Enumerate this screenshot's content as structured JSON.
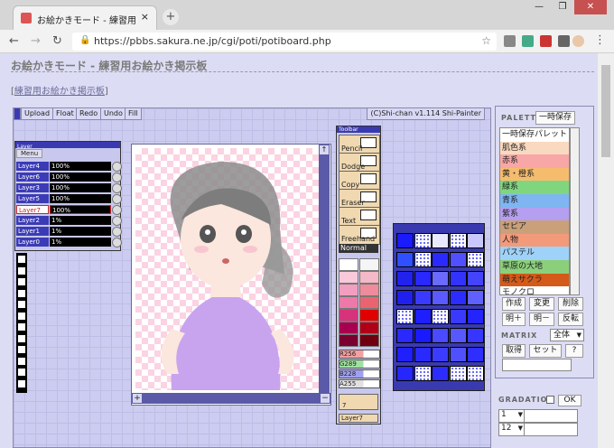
{
  "browser": {
    "tab_title": "お絵かきモード - 練習用お絵かき",
    "tab_close": "×",
    "new_tab": "+",
    "url": "https://pbbs.sakura.ne.jp/cgi/poti/potiboard.php",
    "window_controls": [
      "—",
      "❐",
      "✕"
    ]
  },
  "page": {
    "title": "お絵かきモード - 練習用お絵かき掲示板",
    "back_link_open": "[",
    "back_link": "練習用お絵かき掲示板",
    "back_link_close": "]"
  },
  "applet": {
    "toolbar": [
      "Upload",
      "Float",
      "Redo",
      "Undo",
      "Fill"
    ],
    "credit": "(C)Shi-chan v1.114 Shi-Painter"
  },
  "layers": {
    "menu": "Menu",
    "title": "Layer",
    "rows": [
      {
        "name": "Layer4",
        "opacity": "100%"
      },
      {
        "name": "Layer6",
        "opacity": "100%"
      },
      {
        "name": "Layer3",
        "opacity": "100%"
      },
      {
        "name": "Layer5",
        "opacity": "100%"
      },
      {
        "name": "Layer7",
        "opacity": "100%"
      },
      {
        "name": "Layer2",
        "opacity": "1%"
      },
      {
        "name": "Layer1",
        "opacity": "1%"
      },
      {
        "name": "Layer0",
        "opacity": "1%"
      }
    ]
  },
  "canvas": {
    "scroll_up": "↑",
    "zoom_in": "+",
    "zoom_out": "−"
  },
  "tools": {
    "title": "Toolbar",
    "items": [
      "Pencil",
      "Dodge",
      "Copy",
      "Eraser",
      "Text",
      "Freehand"
    ],
    "mode": "Normal",
    "rgb": [
      "R256",
      "G289",
      "B228",
      "A255"
    ],
    "size": "7",
    "layer": "Layer7",
    "swatches": [
      "#ffffff",
      "#f5f5f5",
      "#f8c9d8",
      "#f3b9c7",
      "#f29ec0",
      "#ef8b9a",
      "#ec79a8",
      "#ea6470",
      "#d6337a",
      "#e00000",
      "#a80050",
      "#b00018",
      "#7a0030",
      "#700010"
    ]
  },
  "textures": {
    "colors": [
      "#1a1aff",
      "#ffffff",
      "#e8e8ff",
      "#ffffff",
      "#c8c8ff",
      "#3050ff",
      "#ffffff",
      "#2a2aff",
      "#5050ff",
      "#ffffff",
      "#2222ee",
      "#2828ff",
      "#6a6aff",
      "#3333ff",
      "#4444ff",
      "#2020ee",
      "#3a3aff",
      "#5a5aff",
      "#2c2cff",
      "#6060ff",
      "#ffffff",
      "#1e1eff",
      "#ffffff",
      "#3a3aff",
      "#2424ff",
      "#2a2aff",
      "#1a1aff",
      "#4a4aff",
      "#5858ff",
      "#3636ff",
      "#2020ff",
      "#2a2aff",
      "#3c3cff",
      "#5050ff",
      "#2e2eff",
      "#2626ff",
      "#ffffff",
      "#2c2cff",
      "#ffffff",
      "#ffffff"
    ]
  },
  "palette": {
    "label": "PALETTE",
    "save_temp": "一時保存",
    "items": [
      {
        "name": "一時保存パレット",
        "color": "#ffffff"
      },
      {
        "name": "肌色系",
        "color": "#f9d9c0"
      },
      {
        "name": "赤系",
        "color": "#f8a6a6"
      },
      {
        "name": "黄・橙系",
        "color": "#f6bc6e"
      },
      {
        "name": "緑系",
        "color": "#7fd67f"
      },
      {
        "name": "青系",
        "color": "#7fb6f2"
      },
      {
        "name": "紫系",
        "color": "#b59ff0"
      },
      {
        "name": "セピア",
        "color": "#c9a07a"
      },
      {
        "name": "人物",
        "color": "#f39a7a"
      },
      {
        "name": "パステル",
        "color": "#9fd2f8"
      },
      {
        "name": "草原の大地",
        "color": "#8bcf7b"
      },
      {
        "name": "萌えサクラ",
        "color": "#d35a1a"
      },
      {
        "name": "モノクロ",
        "color": "#ffffff"
      }
    ],
    "buttons_row1": [
      "作成",
      "変更",
      "削除"
    ],
    "buttons_row2": [
      "明＋",
      "明－",
      "反転"
    ],
    "matrix_label": "MATRIX",
    "matrix_value": "全体",
    "buttons_row3": [
      "取得",
      "セット",
      "?"
    ],
    "gradation_label": "GRADATION",
    "ok": "OK",
    "grad_sel1": "1",
    "grad_sel2": "12"
  }
}
